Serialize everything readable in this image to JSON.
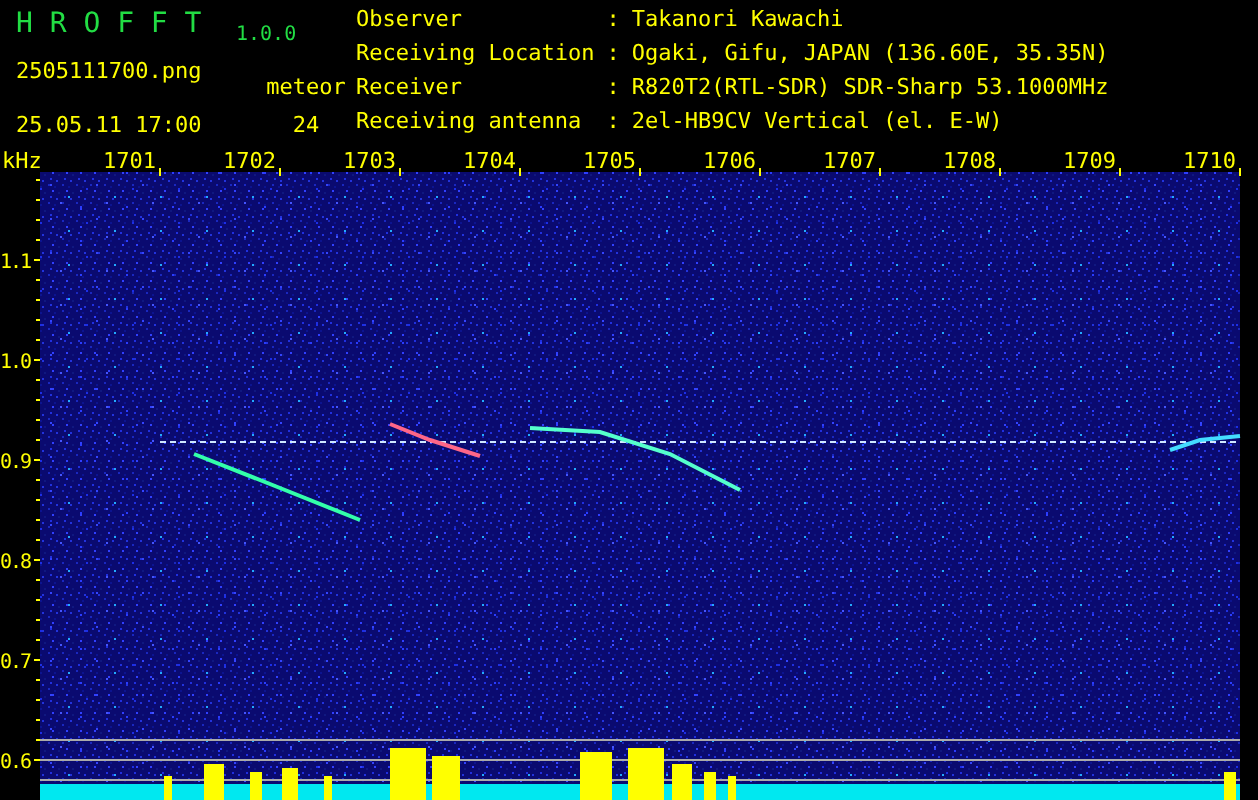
{
  "header": {
    "app_title": "H R O F F T",
    "version": "1.0.0",
    "file_name": "2505111700.png",
    "date_time": "25.05.11 17:00",
    "count_label": "meteor",
    "count": "24",
    "info": [
      {
        "label": "Observer",
        "separator": ":",
        "value": "Takanori Kawachi"
      },
      {
        "label": "Receiving Location",
        "separator": ":",
        "value": "Ogaki, Gifu, JAPAN (136.60E, 35.35N)"
      },
      {
        "label": "Receiver",
        "separator": ":",
        "value": "R820T2(RTL-SDR) SDR-Sharp 53.1000MHz"
      },
      {
        "label": "Receiving antenna",
        "separator": ":",
        "value": "2el-HB9CV Vertical (el. E-W)"
      }
    ]
  },
  "plot": {
    "y_unit": "kHz",
    "x_ticks": [
      "1701",
      "1702",
      "1703",
      "1704",
      "1705",
      "1706",
      "1707",
      "1708",
      "1709",
      "1710"
    ],
    "y_ticks": [
      "1.1",
      "1.0",
      "0.9",
      "0.8",
      "0.7",
      "0.6"
    ]
  }
}
